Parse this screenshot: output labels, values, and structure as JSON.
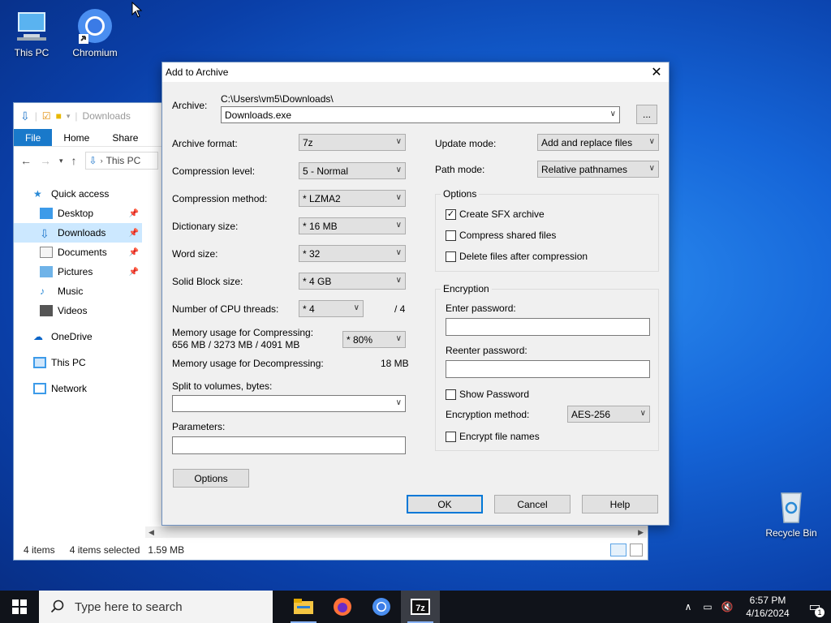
{
  "desktop": {
    "icons": [
      {
        "label": "This PC"
      },
      {
        "label": "Chromium"
      },
      {
        "label": "Recycle Bin"
      }
    ]
  },
  "explorer": {
    "title": "Downloads",
    "ribbon_tabs": [
      "File",
      "Home",
      "Share"
    ],
    "address": "This PC",
    "nav": [
      {
        "label": "Quick access"
      },
      {
        "label": "Desktop"
      },
      {
        "label": "Downloads"
      },
      {
        "label": "Documents"
      },
      {
        "label": "Pictures"
      },
      {
        "label": "Music"
      },
      {
        "label": "Videos"
      },
      {
        "label": "OneDrive"
      },
      {
        "label": "This PC"
      },
      {
        "label": "Network"
      }
    ],
    "status": {
      "items": "4 items",
      "selected": "4 items selected",
      "size": "1.59 MB"
    }
  },
  "dialog": {
    "title": "Add to Archive",
    "archive_label": "Archive:",
    "archive_path": "C:\\Users\\vm5\\Downloads\\",
    "archive_name": "Downloads.exe",
    "browse_label": "...",
    "fields": {
      "format_label": "Archive format:",
      "format_value": "7z",
      "level_label": "Compression level:",
      "level_value": "5 - Normal",
      "method_label": "Compression method:",
      "method_value": "*  LZMA2",
      "dict_label": "Dictionary size:",
      "dict_value": "*  16 MB",
      "word_label": "Word size:",
      "word_value": "*  32",
      "solid_label": "Solid Block size:",
      "solid_value": "*  4 GB",
      "threads_label": "Number of CPU threads:",
      "threads_value": "*  4",
      "threads_max": "/ 4",
      "mem_comp_label": "Memory usage for Compressing:",
      "mem_comp_value": "656 MB / 3273 MB / 4091 MB",
      "mem_comp_pct": "*  80%",
      "mem_decomp_label": "Memory usage for Decompressing:",
      "mem_decomp_value": "18 MB",
      "split_label": "Split to volumes, bytes:",
      "params_label": "Parameters:"
    },
    "options_button": "Options",
    "update_label": "Update mode:",
    "update_value": "Add and replace files",
    "path_label": "Path mode:",
    "path_value": "Relative pathnames",
    "options_group": "Options",
    "opt_sfx": "Create SFX archive",
    "opt_shared": "Compress shared files",
    "opt_delete": "Delete files after compression",
    "enc_group": "Encryption",
    "enc_pass_label": "Enter password:",
    "enc_repass_label": "Reenter password:",
    "enc_show": "Show Password",
    "enc_method_label": "Encryption method:",
    "enc_method_value": "AES-256",
    "enc_names": "Encrypt file names",
    "ok": "OK",
    "cancel": "Cancel",
    "help": "Help"
  },
  "taskbar": {
    "search_placeholder": "Type here to search",
    "time": "6:57 PM",
    "date": "4/16/2024",
    "notif_count": "1"
  }
}
